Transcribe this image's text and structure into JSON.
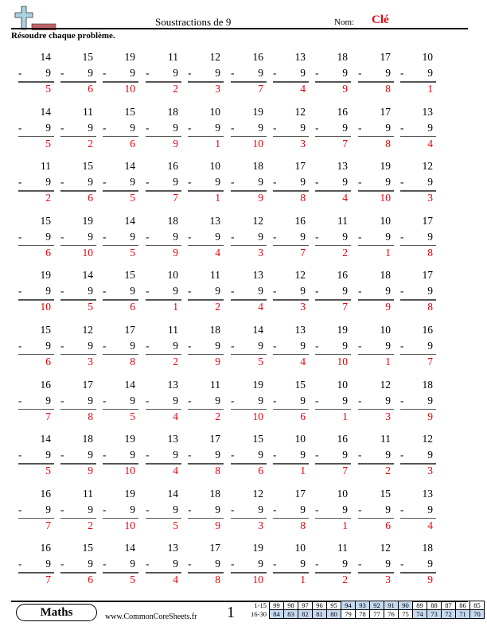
{
  "header": {
    "title": "Soustractions de 9",
    "nom_label": "Nom:",
    "nom_value": "Clé",
    "instructions": "Résoudre chaque problème."
  },
  "colors": {
    "answer": "#e8000b",
    "highlight_cell": "#c6d9f1",
    "logo_cross": "#a8d4e0",
    "logo_bar": "#c0646a"
  },
  "operator": "-",
  "subtrahend": "9",
  "rows": [
    {
      "tops": [
        "14",
        "15",
        "19",
        "11",
        "12",
        "16",
        "13",
        "18",
        "17",
        "10"
      ],
      "answers": [
        "5",
        "6",
        "10",
        "2",
        "3",
        "7",
        "4",
        "9",
        "8",
        "1"
      ]
    },
    {
      "tops": [
        "14",
        "11",
        "15",
        "18",
        "10",
        "19",
        "12",
        "16",
        "17",
        "13"
      ],
      "answers": [
        "5",
        "2",
        "6",
        "9",
        "1",
        "10",
        "3",
        "7",
        "8",
        "4"
      ]
    },
    {
      "tops": [
        "11",
        "15",
        "14",
        "16",
        "10",
        "18",
        "17",
        "13",
        "19",
        "12"
      ],
      "answers": [
        "2",
        "6",
        "5",
        "7",
        "1",
        "9",
        "8",
        "4",
        "10",
        "3"
      ]
    },
    {
      "tops": [
        "15",
        "19",
        "14",
        "18",
        "13",
        "12",
        "16",
        "11",
        "10",
        "17"
      ],
      "answers": [
        "6",
        "10",
        "5",
        "9",
        "4",
        "3",
        "7",
        "2",
        "1",
        "8"
      ]
    },
    {
      "tops": [
        "19",
        "14",
        "15",
        "10",
        "11",
        "13",
        "12",
        "16",
        "18",
        "17"
      ],
      "answers": [
        "10",
        "5",
        "6",
        "1",
        "2",
        "4",
        "3",
        "7",
        "9",
        "8"
      ]
    },
    {
      "tops": [
        "15",
        "12",
        "17",
        "11",
        "18",
        "14",
        "13",
        "19",
        "10",
        "16"
      ],
      "answers": [
        "6",
        "3",
        "8",
        "2",
        "9",
        "5",
        "4",
        "10",
        "1",
        "7"
      ]
    },
    {
      "tops": [
        "16",
        "17",
        "14",
        "13",
        "11",
        "19",
        "15",
        "10",
        "12",
        "18"
      ],
      "answers": [
        "7",
        "8",
        "5",
        "4",
        "2",
        "10",
        "6",
        "1",
        "3",
        "9"
      ]
    },
    {
      "tops": [
        "14",
        "18",
        "19",
        "13",
        "17",
        "15",
        "10",
        "16",
        "11",
        "12"
      ],
      "answers": [
        "5",
        "9",
        "10",
        "4",
        "8",
        "6",
        "1",
        "7",
        "2",
        "3"
      ]
    },
    {
      "tops": [
        "16",
        "11",
        "19",
        "14",
        "18",
        "12",
        "17",
        "10",
        "15",
        "13"
      ],
      "answers": [
        "7",
        "2",
        "10",
        "5",
        "9",
        "3",
        "8",
        "1",
        "6",
        "4"
      ]
    },
    {
      "tops": [
        "16",
        "15",
        "14",
        "13",
        "17",
        "19",
        "10",
        "11",
        "12",
        "18"
      ],
      "answers": [
        "7",
        "6",
        "5",
        "4",
        "8",
        "10",
        "1",
        "2",
        "3",
        "9"
      ]
    }
  ],
  "footer": {
    "subject": "Maths",
    "site": "www.CommonCoreSheets.fr",
    "page": "1",
    "score_rows": [
      {
        "label": "1-15",
        "values": [
          "99",
          "98",
          "97",
          "96",
          "95",
          "94",
          "93",
          "92",
          "91",
          "90",
          "89",
          "88",
          "87",
          "86",
          "85"
        ],
        "highlighted": [
          false,
          false,
          false,
          false,
          false,
          true,
          true,
          true,
          true,
          true,
          false,
          false,
          false,
          false,
          false
        ]
      },
      {
        "label": "16-30",
        "values": [
          "84",
          "83",
          "82",
          "81",
          "80",
          "79",
          "78",
          "77",
          "76",
          "75",
          "74",
          "73",
          "72",
          "71",
          "70"
        ],
        "highlighted": [
          true,
          true,
          true,
          true,
          true,
          false,
          false,
          false,
          false,
          false,
          true,
          true,
          true,
          true,
          true
        ]
      }
    ]
  }
}
